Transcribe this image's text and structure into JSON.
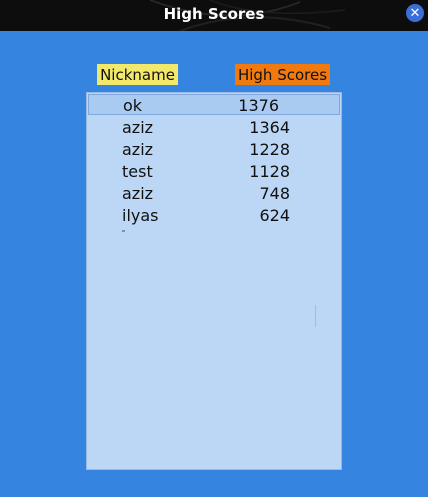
{
  "window": {
    "title": "High Scores"
  },
  "headers": {
    "nickname": "Nickname",
    "high_scores": "High Scores"
  },
  "rows": [
    {
      "nickname": "ok",
      "score": "1376"
    },
    {
      "nickname": "aziz",
      "score": "1364"
    },
    {
      "nickname": "aziz",
      "score": "1228"
    },
    {
      "nickname": "test",
      "score": "1128"
    },
    {
      "nickname": "aziz",
      "score": "748"
    },
    {
      "nickname": "ilyas",
      "score": "624"
    }
  ],
  "colors": {
    "background": "#3484e0",
    "nickname_header": "#f2e86a",
    "score_header": "#f07a10",
    "list_background": "#bcd6f5"
  },
  "icons": {
    "close": "close-icon"
  }
}
